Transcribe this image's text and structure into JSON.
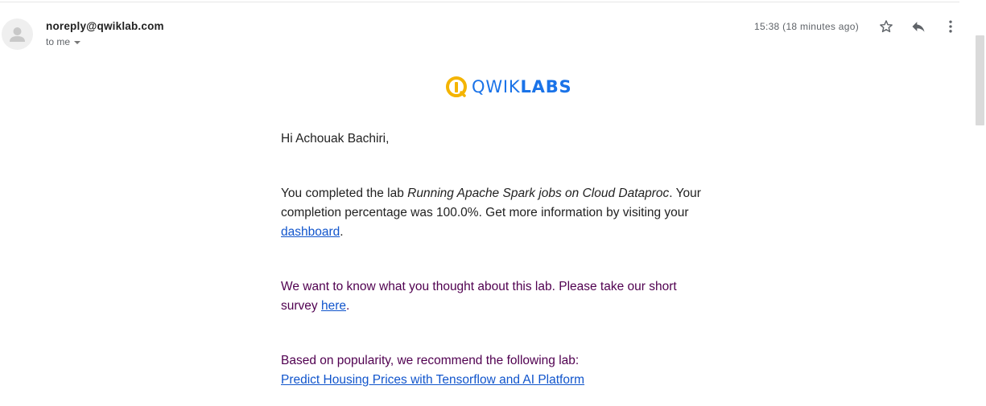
{
  "header": {
    "sender": "noreply@qwiklab.com",
    "recipient_label": "to me",
    "timestamp": "15:38 (18 minutes ago)",
    "icons": [
      "avatar-icon",
      "star-icon",
      "reply-icon",
      "more-vert-icon"
    ]
  },
  "logo": {
    "text_light": "QWIK",
    "text_bold": "LABS",
    "icon": "qwiklabs-logo-icon",
    "accent_color": "#f4b400",
    "brand_color": "#1a73e8"
  },
  "email": {
    "greeting": "Hi Achouak Bachiri,",
    "completion_prefix": "You completed the lab ",
    "lab_name": "Running Apache Spark jobs on Cloud Dataproc",
    "completion_middle": ". Your completion percentage was 100.0%. Get more information by visiting your ",
    "dashboard_link": "dashboard",
    "completion_suffix": ".",
    "survey_prefix": "We want to know what you thought about this lab. Please take our short survey ",
    "survey_link": "here",
    "survey_suffix": ".",
    "recommend_text": "Based on popularity, we recommend the following lab:",
    "recommend_link": "Predict Housing Prices with Tensorflow and AI Platform"
  },
  "colors": {
    "link": "#1155cc",
    "quoted_text": "#500050",
    "body_text": "#222222",
    "meta_text": "#5f6368"
  }
}
